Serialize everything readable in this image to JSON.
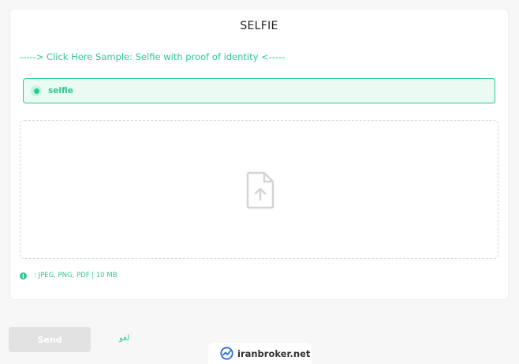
{
  "form": {
    "title": "SELFIE",
    "sample_link": "-----> Click Here Sample: Selfie with proof of identity <-----",
    "option": {
      "label": "selfie",
      "selected": true
    },
    "upload": {
      "icon": "file-upload-icon"
    },
    "formats_text": ": JPEG, PNG, PDF | 10 MB",
    "info_icon": "info-icon"
  },
  "actions": {
    "send_label": "Send",
    "cancel_label": "لغو"
  },
  "watermark": {
    "text": "iranbroker.net",
    "logo": "iranbroker-logo"
  },
  "colors": {
    "accent": "#2ec990",
    "accent_bg": "#e9fbf3",
    "disabled_button": "#e2e2e2",
    "page_bg": "#f7f7f7"
  }
}
